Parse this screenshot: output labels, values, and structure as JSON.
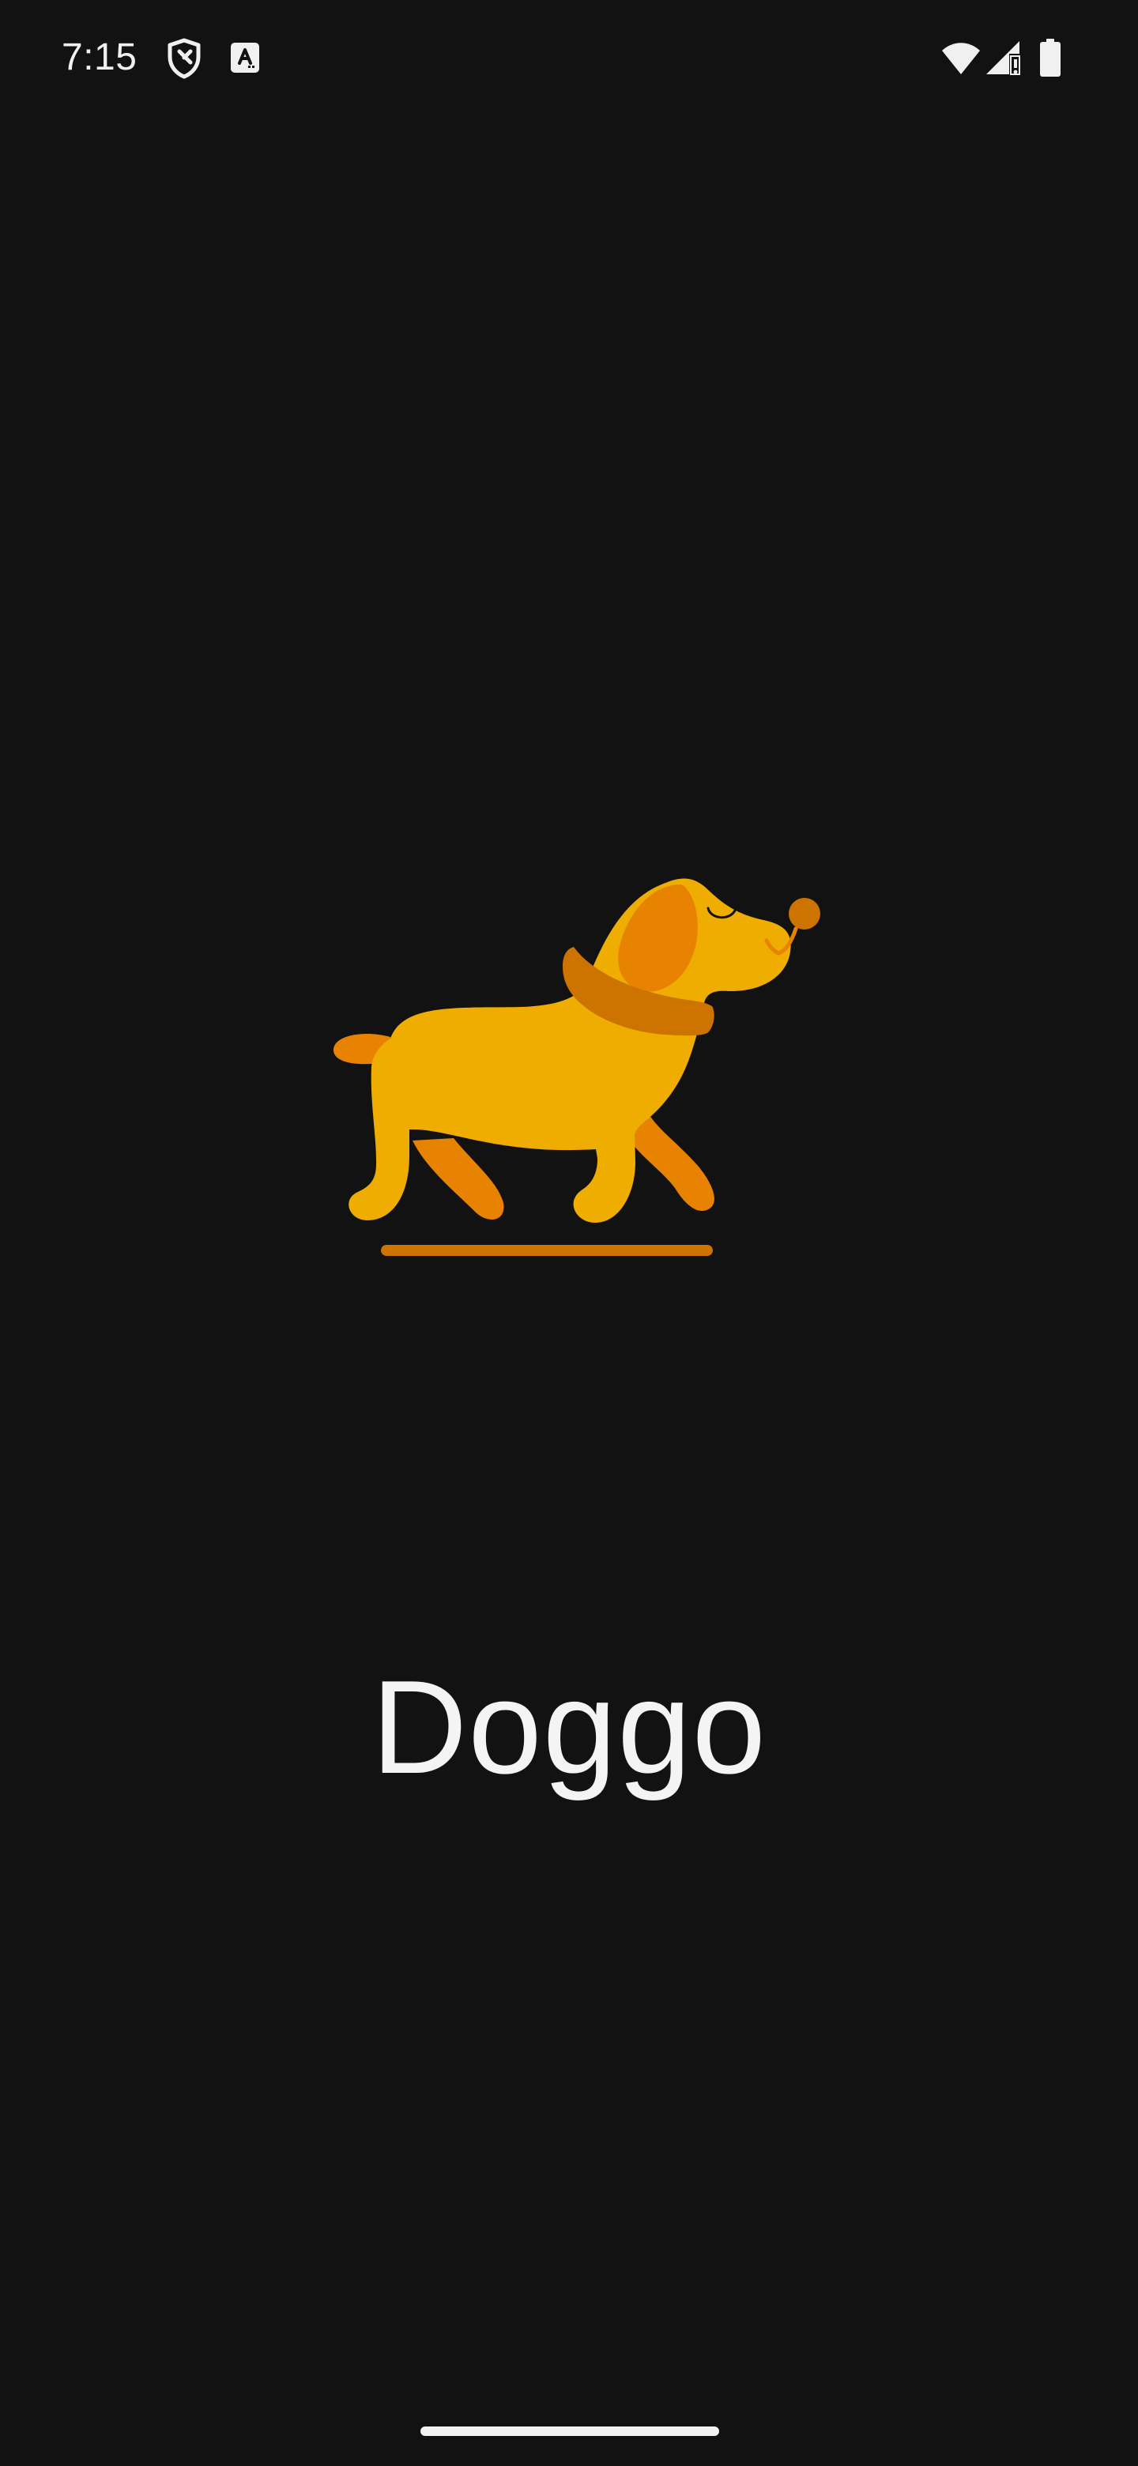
{
  "status_bar": {
    "time": "7:15",
    "icons": [
      "shield-icon",
      "text-a-icon",
      "wifi-icon",
      "cellular-signal-icon",
      "battery-icon"
    ]
  },
  "splash": {
    "illustration": "dog-icon",
    "app_name": "Doggo"
  },
  "colors": {
    "background": "#121213",
    "dog_body": "#EEAD00",
    "dog_ear_tail_legs": "#E78300",
    "dog_collar_nose": "#CC7300",
    "text": "#F4F4F4"
  }
}
